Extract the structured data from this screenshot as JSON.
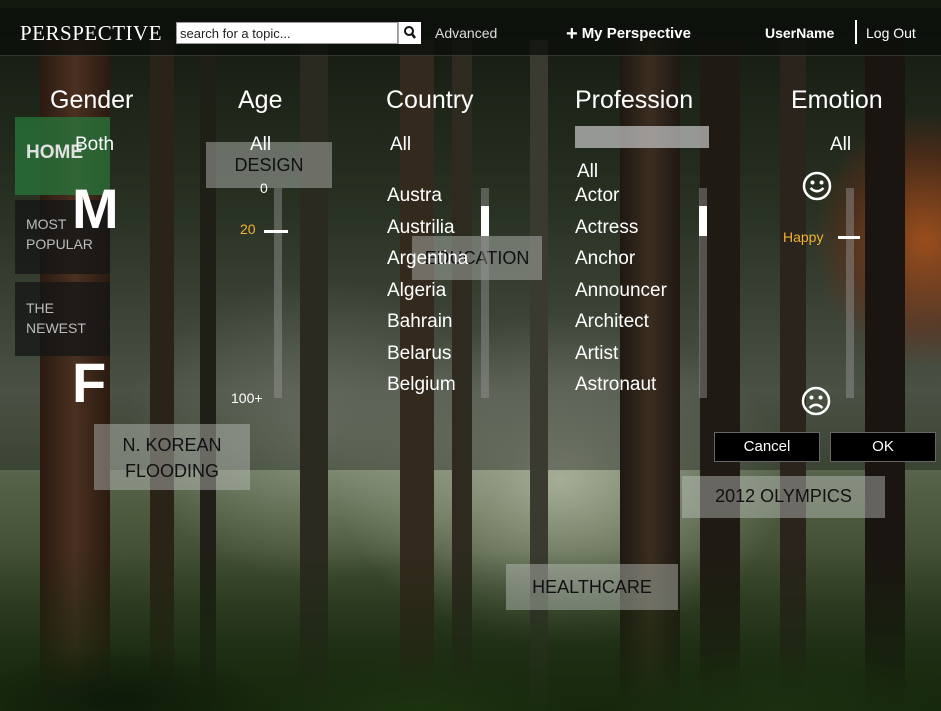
{
  "header": {
    "logo": "PERSPECTIVE",
    "search_value": "search for a topic...",
    "advanced": "Advanced",
    "my_perspective": "My Perspective",
    "plus": "+",
    "username": "UserName",
    "logout": "Log Out"
  },
  "nav": {
    "home": "HOME",
    "most_popular_1": "MOST",
    "most_popular_2": "POPULAR",
    "newest_1": "THE",
    "newest_2": "NEWEST"
  },
  "tiles": {
    "design": "DESIGN",
    "education": "EDUCATION",
    "korea_1": "N. KOREAN",
    "korea_2": "FLOODING",
    "olympics": "2012 OLYMPICS",
    "healthcare": "HEALTHCARE"
  },
  "filters": {
    "gender": {
      "heading": "Gender",
      "selected": "Both",
      "male": "M",
      "female": "F"
    },
    "age": {
      "heading": "Age",
      "selected": "All",
      "min": "0",
      "current": "20",
      "max": "100+",
      "current_fraction": 0.2
    },
    "country": {
      "heading": "Country",
      "selected": "All",
      "items": [
        "Austra",
        "Austrilia",
        "Argentina",
        "Algeria",
        "Bahrain",
        "Belarus",
        "Belgium"
      ]
    },
    "profession": {
      "heading": "Profession",
      "selected": "All",
      "search_value": "",
      "items": [
        "Actor",
        "Actress",
        "Anchor",
        "Announcer",
        "Architect",
        "Artist",
        "Astronaut"
      ]
    },
    "emotion": {
      "heading": "Emotion",
      "selected": "All",
      "current": "Happy"
    }
  },
  "actions": {
    "cancel": "Cancel",
    "ok": "OK"
  },
  "colors": {
    "accent": "#f2b233",
    "nav_home": "#287a3c"
  }
}
